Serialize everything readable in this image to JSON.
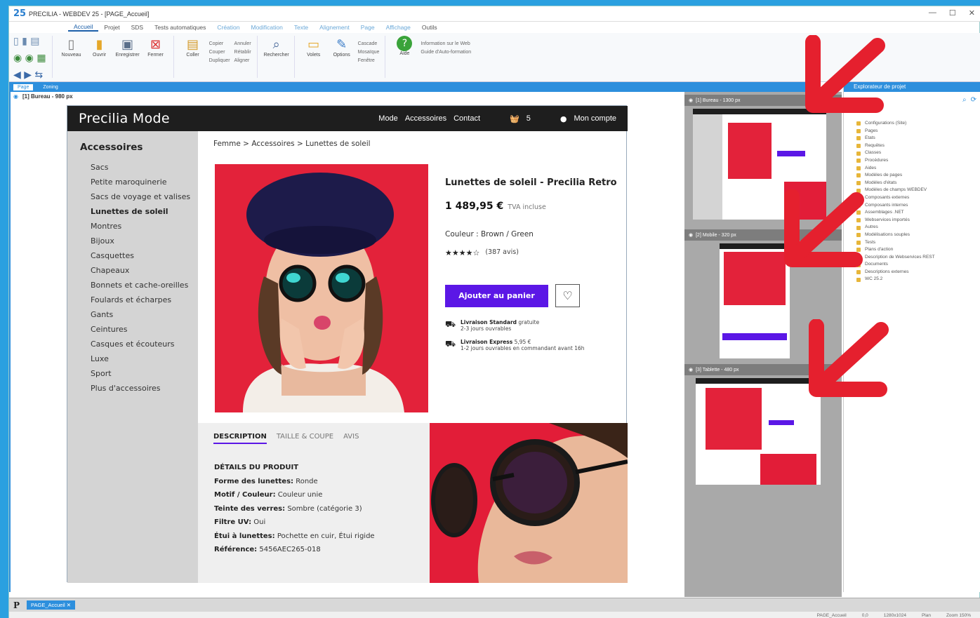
{
  "window": {
    "title": "PRECILIA - WEBDEV 25 - [PAGE_Accueil]"
  },
  "menu": [
    "Accueil",
    "Projet",
    "SDS",
    "Tests automatiques",
    "Création",
    "Modification",
    "Texte",
    "Alignement",
    "Page",
    "Affichage",
    "Outils"
  ],
  "ribbon": {
    "buttons": [
      "Nouveau",
      "Ouvrir",
      "Enregistrer",
      "Fermer",
      "Coller",
      "Rechercher",
      "Volets",
      "Options",
      "Aide"
    ],
    "small": [
      "Copier",
      "Couper",
      "Dupliquer",
      "Annuler",
      "Rétablir",
      "Aligner",
      "Cascade",
      "Mosaïque",
      "Fenêtre",
      "Information sur le Web",
      "Guide d'Auto-formation"
    ]
  },
  "doc_tabs": {
    "page": "Page",
    "zoning": "Zoning"
  },
  "editor": {
    "label": "[1] Bureau - 980 px"
  },
  "site": {
    "brand": "Precilia Mode",
    "nav": [
      "Mode",
      "Accessoires",
      "Contact"
    ],
    "cart_count": "5",
    "account": "Mon compte"
  },
  "sidebar": {
    "title": "Accessoires",
    "items": [
      "Sacs",
      "Petite maroquinerie",
      "Sacs de voyage et valises",
      "Lunettes de soleil",
      "Montres",
      "Bijoux",
      "Casquettes",
      "Chapeaux",
      "Bonnets et cache-oreilles",
      "Foulards et écharpes",
      "Gants",
      "Ceintures",
      "Casques et écouteurs",
      "Luxe",
      "Sport",
      "Plus d'accessoires"
    ],
    "current": "Lunettes de soleil"
  },
  "breadcrumb": "Femme > Accessoires > Lunettes de soleil",
  "product": {
    "title": "Lunettes de soleil - Precilia Retro",
    "price": "1 489,95 €",
    "tva": "TVA incluse",
    "color": "Couleur : Brown / Green",
    "rating": 4,
    "stars": "★★★★☆",
    "reviews": "(387 avis)",
    "add_to_cart": "Ajouter au panier"
  },
  "shipping": [
    {
      "title": "Livraison Standard",
      "note": "gratuite",
      "detail": "2-3 jours ouvrables"
    },
    {
      "title": "Livraison Express",
      "note": "5,95 €",
      "detail": "1-2 jours ouvrables en commandant avant 16h"
    }
  ],
  "tabs": [
    "DESCRIPTION",
    "TAILLE & COUPE",
    "AVIS"
  ],
  "details": {
    "heading": "DÉTAILS DU PRODUIT",
    "rows": [
      {
        "k": "Forme des lunettes:",
        "v": "Ronde"
      },
      {
        "k": "Motif / Couleur:",
        "v": "Couleur unie"
      },
      {
        "k": "Teinte des verres:",
        "v": "Sombre (catégorie 3)"
      },
      {
        "k": "Filtre UV:",
        "v": "Oui"
      },
      {
        "k": "Étui à lunettes:",
        "v": "Pochette en cuir, Étui rigide"
      },
      {
        "k": "Référence:",
        "v": "5456AEC265-018"
      }
    ]
  },
  "previews": {
    "p1": "[1] Bureau - 1300 px",
    "p2": "[2] Mobile - 320 px",
    "p3": "[3] Tablette - 480 px"
  },
  "explorer": {
    "title": "Explorateur de projet",
    "items": [
      "Configurations (Site)",
      "Pages",
      "Etats",
      "Requêtes",
      "Classes",
      "Procédures",
      "Aides",
      "Modèles de pages",
      "Modèles d'états",
      "Modèles de champs WEBDEV",
      "Composants externes",
      "Composants internes",
      "Assemblages .NET",
      "Webservices importés",
      "Autres",
      "Modélisations souples",
      "Tests",
      "Plans d'action",
      "Description de Webservices REST",
      "Documents",
      "Descriptions externes",
      "WC 25.2"
    ]
  },
  "status": {
    "doc": "PAGE_Accueil",
    "page_name": "PAGE_Accueil",
    "pos": "0,0",
    "size": "1280x1024",
    "mode": "Plan",
    "zoom": "Zoom 150%"
  },
  "colors": {
    "accent": "#5b17e6",
    "product_red": "#e3223a",
    "header_dark": "#1e1e1e",
    "ide_blue": "#2d8fdd",
    "arrow_red": "#e5202e"
  }
}
